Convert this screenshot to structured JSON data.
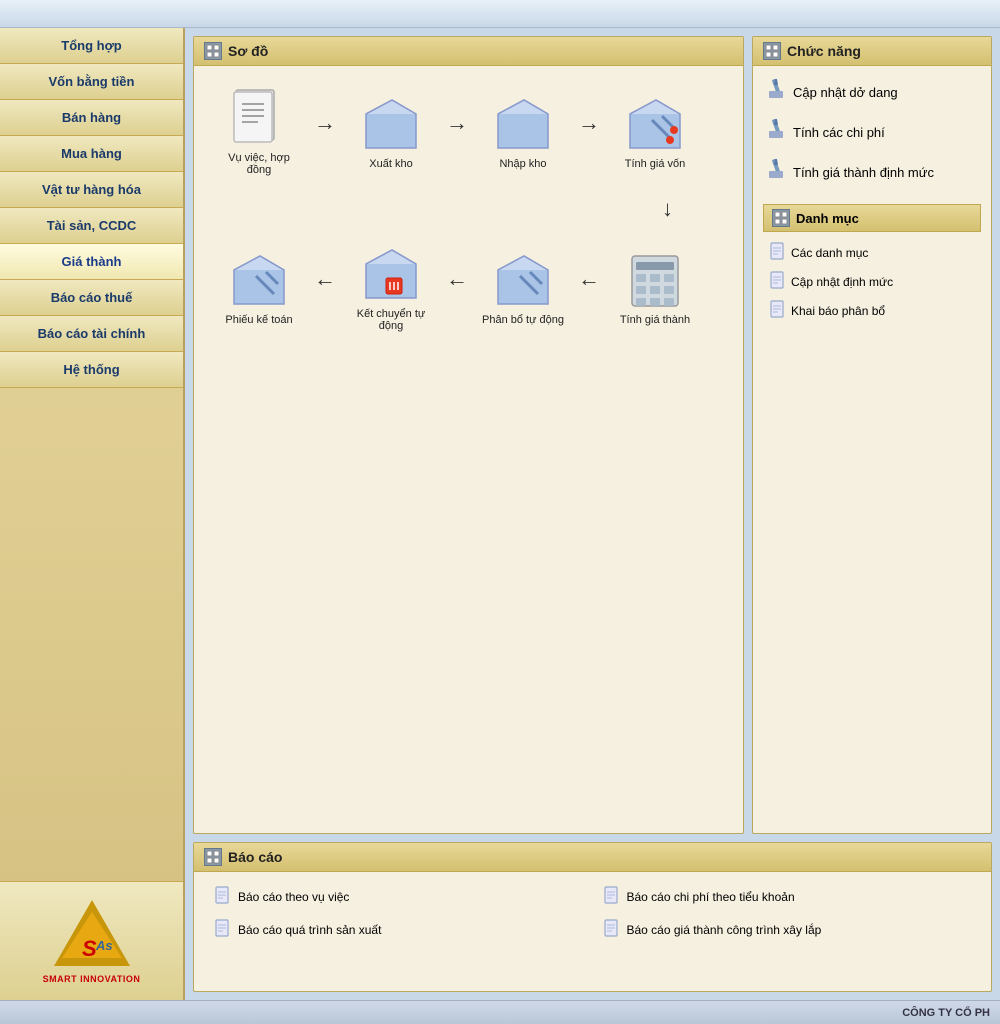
{
  "topBar": {},
  "sidebar": {
    "items": [
      {
        "label": "Tổng hợp",
        "id": "tong-hop"
      },
      {
        "label": "Vốn bằng tiền",
        "id": "von-bang-tien"
      },
      {
        "label": "Bán hàng",
        "id": "ban-hang"
      },
      {
        "label": "Mua hàng",
        "id": "mua-hang"
      },
      {
        "label": "Vật tư hàng hóa",
        "id": "vat-tu-hang-hoa"
      },
      {
        "label": "Tài sản, CCDC",
        "id": "tai-san-ccdc"
      },
      {
        "label": "Giá thành",
        "id": "gia-thanh",
        "active": true
      },
      {
        "label": "Báo cáo thuế",
        "id": "bao-cao-thue"
      },
      {
        "label": "Báo cáo tài chính",
        "id": "bao-cao-tai-chinh"
      },
      {
        "label": "Hệ thống",
        "id": "he-thong"
      }
    ],
    "logoTextTop": "SAs",
    "logoTextBottom": "SMART INNOVATION"
  },
  "soDo": {
    "title": "Sơ đồ",
    "row1": [
      {
        "label": "Vụ việc, hợp đồng",
        "type": "doc"
      },
      {
        "label": "Xuất kho",
        "type": "folder"
      },
      {
        "label": "Nhập kho",
        "type": "folder"
      },
      {
        "label": "Tính giá vốn",
        "type": "folder-pen"
      }
    ],
    "row2": [
      {
        "label": "Tính giá thành",
        "type": "calc"
      },
      {
        "label": "Phân bổ tự động",
        "type": "folder-pen"
      },
      {
        "label": "Kết chuyển tự động",
        "type": "folder-pin"
      },
      {
        "label": "Phiếu kế toán",
        "type": "folder-pen"
      }
    ]
  },
  "chucNang": {
    "title": "Chức năng",
    "items": [
      {
        "label": "Cập nhật dở dang"
      },
      {
        "label": "Tính các chi phí"
      },
      {
        "label": "Tính giá thành định mức"
      }
    ],
    "danhMuc": {
      "title": "Danh mục",
      "items": [
        {
          "label": "Các danh mục"
        },
        {
          "label": "Cập nhật định mức"
        },
        {
          "label": "Khai báo phân bổ"
        }
      ]
    }
  },
  "baoCao": {
    "title": "Báo cáo",
    "items": [
      {
        "label": "Báo cáo theo vụ việc"
      },
      {
        "label": "Báo cáo chi phí theo tiểu khoản"
      },
      {
        "label": "Báo cáo quá trình sản xuất"
      },
      {
        "label": "Báo cáo giá thành công trình xây lắp"
      }
    ]
  },
  "bottomBar": {
    "companyText": "CÔNG TY CỔ PH"
  }
}
